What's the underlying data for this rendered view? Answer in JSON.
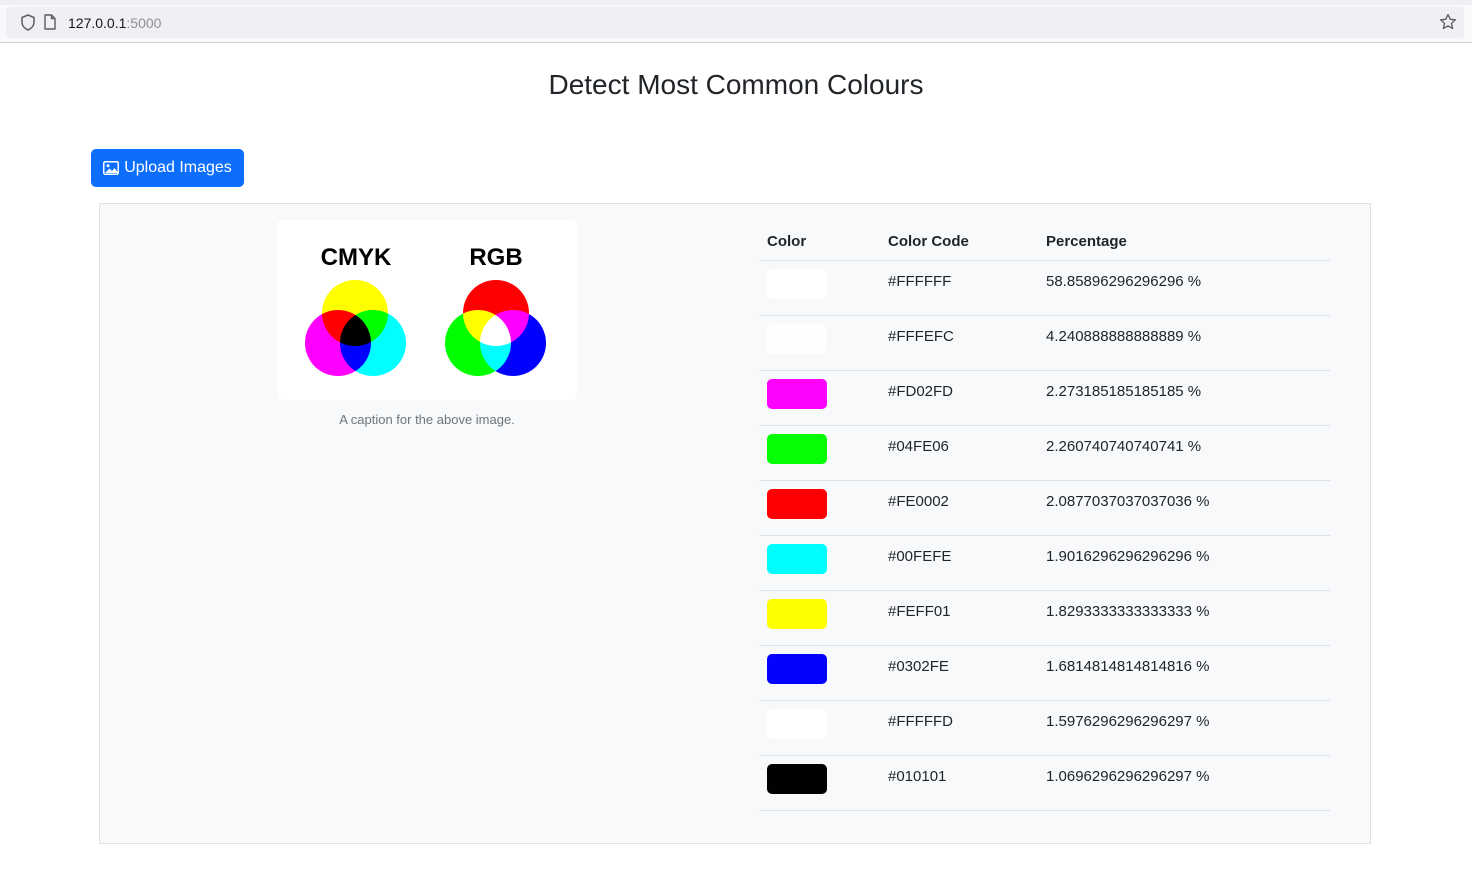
{
  "browser": {
    "url_host": "127.0.0.1",
    "url_port": ":5000"
  },
  "page": {
    "title": "Detect Most Common Colours",
    "upload_label": "Upload Images"
  },
  "figure": {
    "cmyk_label": "CMYK",
    "rgb_label": "RGB",
    "caption": "A caption for the above image."
  },
  "table": {
    "headers": {
      "color": "Color",
      "code": "Color Code",
      "percentage": "Percentage"
    },
    "rows": [
      {
        "code": "#FFFFFF",
        "percentage": "58.85896296296296 %"
      },
      {
        "code": "#FFFEFC",
        "percentage": "4.240888888888889 %"
      },
      {
        "code": "#FD02FD",
        "percentage": "2.273185185185185 %"
      },
      {
        "code": "#04FE06",
        "percentage": "2.260740740740741 %"
      },
      {
        "code": "#FE0002",
        "percentage": "2.0877037037037036 %"
      },
      {
        "code": "#00FEFE",
        "percentage": "1.9016296296296296 %"
      },
      {
        "code": "#FEFF01",
        "percentage": "1.8293333333333333 %"
      },
      {
        "code": "#0302FE",
        "percentage": "1.6814814814814816 %"
      },
      {
        "code": "#FFFFFD",
        "percentage": "1.5976296296296297 %"
      },
      {
        "code": "#010101",
        "percentage": "1.0696296296296297 %"
      }
    ]
  },
  "colors": {
    "accent": "#0d6efd",
    "panel_bg": "#f8f9fa"
  }
}
